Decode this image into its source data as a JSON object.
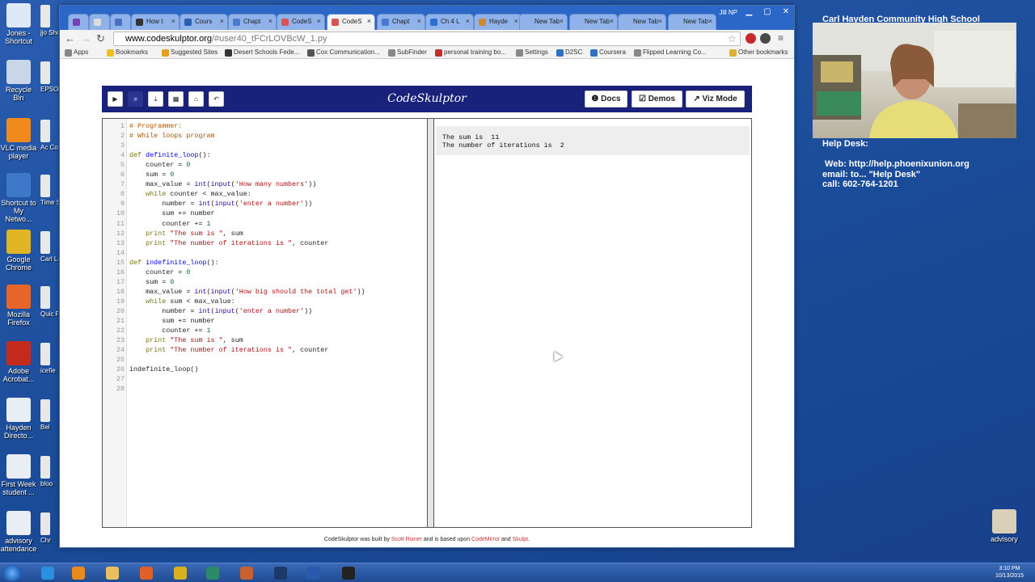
{
  "desktop": {
    "icons": [
      {
        "label": "Jones - Shortcut",
        "color": "#dfe8f6"
      },
      {
        "label": "Recycle Bin",
        "color": "#c9d6e8"
      },
      {
        "label": "VLC media player",
        "color": "#f08a1c"
      },
      {
        "label": "Shortcut to My Netwo...",
        "color": "#3d78c9"
      },
      {
        "label": "Google Chrome",
        "color": "#e0b422"
      },
      {
        "label": "Mozilla Firefox",
        "color": "#e8652a"
      },
      {
        "label": "Adobe Acrobat...",
        "color": "#c42b1c"
      },
      {
        "label": "Hayden Directo...",
        "color": "#e9eef5"
      },
      {
        "label": "First Week student ...",
        "color": "#e9eef5"
      },
      {
        "label": "advisory attendance",
        "color": "#e9eef5"
      }
    ],
    "icons_col2": [
      "jjo Sho",
      "EPSO",
      "Ac Co",
      "Time Sy",
      "Carl Lette",
      "Quic Pl",
      "icefie",
      "Bel",
      "bloo",
      "Chr"
    ],
    "right_icon": "advisory"
  },
  "browser": {
    "user": "Jill NP",
    "tabs": [
      {
        "label": "",
        "color": "#7a3fb0"
      },
      {
        "label": "",
        "color": "#ddd"
      },
      {
        "label": "",
        "color": "#4a70c0"
      },
      {
        "label": "How t",
        "color": "#333"
      },
      {
        "label": "Cours",
        "color": "#2a5fb0"
      },
      {
        "label": "Chapt",
        "color": "#4a7ad0"
      },
      {
        "label": "CodeS",
        "color": "#d9534f"
      },
      {
        "label": "CodeS",
        "color": "#d9534f"
      },
      {
        "label": "Chapt",
        "color": "#4a7ad0"
      },
      {
        "label": "Ch 4 L",
        "color": "#2a6fd0"
      },
      {
        "label": "Hayde",
        "color": "#d08a2a"
      },
      {
        "label": "New Tab",
        "color": ""
      },
      {
        "label": "New Tab",
        "color": ""
      },
      {
        "label": "New Tab",
        "color": ""
      },
      {
        "label": "New Tab",
        "color": ""
      }
    ],
    "url_host": "www.codeskulptor.org",
    "url_path": "/#user40_tFCrLOVBcW_1.py",
    "bookmarks": [
      {
        "label": "Apps",
        "color": "#888"
      },
      {
        "label": "Bookmarks",
        "color": "#f0c020"
      },
      {
        "label": "Suggested Sites",
        "color": "#e0a020"
      },
      {
        "label": "Desert Schools Fede...",
        "color": "#333"
      },
      {
        "label": "Cox Communication...",
        "color": "#555"
      },
      {
        "label": "SubFinder",
        "color": "#888"
      },
      {
        "label": "personal training bo...",
        "color": "#c03030"
      },
      {
        "label": "Settings",
        "color": "#888"
      },
      {
        "label": "D2SC",
        "color": "#3070c0"
      },
      {
        "label": "Coursera",
        "color": "#3070c0"
      },
      {
        "label": "Flipped Learning Co...",
        "color": "#888"
      },
      {
        "label": "Other bookmarks",
        "color": "#e0b030"
      }
    ]
  },
  "codeskulptor": {
    "title": "CodeSkulptor",
    "toolbar": [
      "▶",
      "■",
      "⤓",
      "▦",
      "⌂",
      "↶"
    ],
    "docs": "❶ Docs",
    "demos": "☑ Demos",
    "viz": "↗ Viz Mode",
    "lines": [
      "# Programmer:",
      "# While loops program",
      "",
      "def definite_loop():",
      "    counter = 0",
      "    sum = 0",
      "    max_value = int(input('How many numbers'))",
      "    while counter < max_value:",
      "        number = int(input('enter a number'))",
      "        sum += number",
      "        counter += 1",
      "    print \"The sum is \", sum",
      "    print \"The number of iterations is \", counter",
      "",
      "def indefinite_loop():",
      "    counter = 0",
      "    sum = 0",
      "    max_value = int(input('How big should the total get'))",
      "    while sum < max_value:",
      "        number = int(input('enter a number'))",
      "        sum += number",
      "        counter += 1",
      "    print \"The sum is \", sum",
      "    print \"The number of iterations is \", counter",
      "",
      "indefinite_loop()",
      "",
      ""
    ],
    "output": "The sum is  11\nThe number of iterations is  2",
    "footer_1": "CodeSkulptor was built by ",
    "footer_link1": "Scott Rixner",
    "footer_2": " and is based upon ",
    "footer_link2": "CodeMirror",
    "footer_3": " and ",
    "footer_link3": "Skulpt",
    "footer_4": "."
  },
  "overlay": {
    "school": "Carl Hayden Community High School",
    "helpdesk": "Help Desk:\n\n Web: http://help.phoenixunion.org\nemail: to... \"Help Desk\"\ncall: 602-764-1201"
  },
  "taskbar": {
    "time": "3:10 PM",
    "date": "10/13/2015",
    "apps": [
      {
        "name": "ie",
        "color": "#2a8fe0"
      },
      {
        "name": "media",
        "color": "#e88a20"
      },
      {
        "name": "explorer",
        "color": "#e8c060"
      },
      {
        "name": "firefox",
        "color": "#e0602a"
      },
      {
        "name": "chrome",
        "color": "#d8b020"
      },
      {
        "name": "publisher",
        "color": "#2a8a6a"
      },
      {
        "name": "app",
        "color": "#c86030"
      },
      {
        "name": "photoshop",
        "color": "#1a3a6a"
      },
      {
        "name": "word",
        "color": "#2a5ab0"
      },
      {
        "name": "obs",
        "color": "#222"
      }
    ]
  }
}
